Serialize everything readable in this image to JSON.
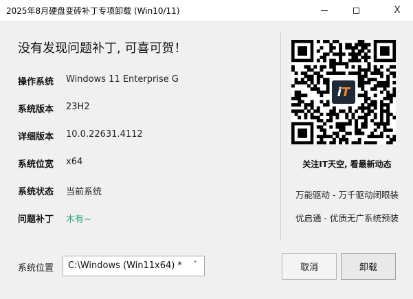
{
  "window": {
    "title": "2025年8月硬盘变砖补丁专项卸载 (Win10/11)",
    "minimize": "—",
    "maximize": "☐",
    "close": "X"
  },
  "main": {
    "headline": "没有发现问题补丁, 可喜可贺！",
    "rows": [
      {
        "label": "操作系统",
        "value": "Windows 11 Enterprise G"
      },
      {
        "label": "系统版本",
        "value": "23H2"
      },
      {
        "label": "详细版本",
        "value": "10.0.22631.4112"
      },
      {
        "label": "系统位宽",
        "value": "x64"
      },
      {
        "label": "系统状态",
        "value": "当前系统"
      },
      {
        "label": "问题补丁",
        "value": "木有~"
      }
    ],
    "accent_green": "#2aa876"
  },
  "side": {
    "qr_logo_text_i": "i",
    "qr_logo_text_t": "T",
    "follow": "关注IT天空, 看最新动态",
    "promo1": "万能驱动 - 万千驱动闭眼装",
    "promo2": "优启通 - 优质无广系统预装"
  },
  "bottom": {
    "location_label": "系统位置",
    "location_value": "C:\\Windows (Win11x64) *",
    "chevron": "˅",
    "cancel_label": "取消",
    "uninstall_label": "卸载"
  }
}
